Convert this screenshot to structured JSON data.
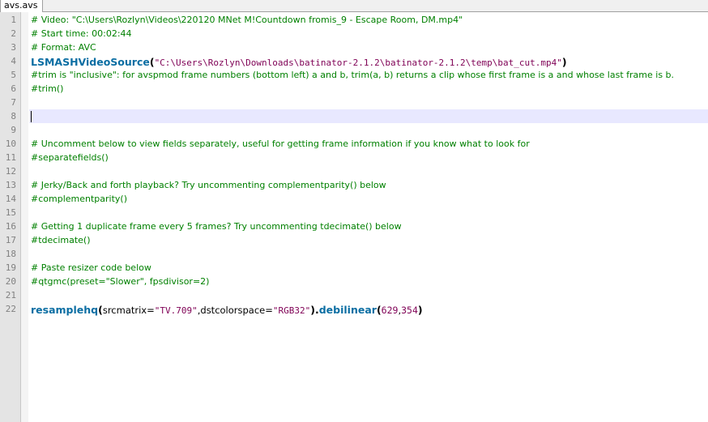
{
  "tab": {
    "label": "avs.avs"
  },
  "line_numbers": [
    "1",
    "2",
    "3",
    "4",
    "5",
    "6",
    "7",
    "8",
    "9",
    "10",
    "11",
    "12",
    "13",
    "14",
    "15",
    "16",
    "17",
    "18",
    "19",
    "20",
    "21",
    "22"
  ],
  "lines": {
    "l1": "# Video: \"C:\\Users\\Rozlyn\\Videos\\220120 MNet M!Countdown fromis_9 - Escape Room, DM.mp4\"",
    "l2": "# Start time: 00:02:44",
    "l3": "# Format: AVC",
    "l4": {
      "fn": "LSMASHVideoSource",
      "open": "(",
      "str": "\"C:\\Users\\Rozlyn\\Downloads\\batinator-2.1.2\\batinator-2.1.2\\temp\\bat_cut.mp4\"",
      "close": ")"
    },
    "l5": "#trim is \"inclusive\": for avspmod frame numbers (bottom left) a and b, trim(a, b) returns a clip whose first frame is a and whose last frame is b.",
    "l6": "#trim()",
    "l10": "# Uncomment below to view fields separately, useful for getting frame information if you know what to look for",
    "l11": "#separatefields()",
    "l13": "# Jerky/Back and forth playback? Try uncommenting complementparity() below",
    "l14": "#complementparity()",
    "l16": "# Getting 1 duplicate frame every 5 frames? Try uncommenting tdecimate() below",
    "l17": "#tdecimate()",
    "l19": "# Paste resizer code below",
    "l20": "#qtgmc(preset=\"Slower\", fpsdivisor=2)",
    "l22": {
      "fn1": "resamplehq",
      "open1": "(",
      "arg1": "srcmatrix=",
      "str1": "\"TV.709\"",
      "comma1": ",",
      "arg2": "dstcolorspace=",
      "str2": "\"RGB32\"",
      "close1": ")",
      "dot": ".",
      "fn2": "debilinear",
      "open2": "(",
      "num1": "629",
      "comma2": ",",
      "num2": "354",
      "close2": ")"
    }
  },
  "colors": {
    "comment": "#008000",
    "function": "#0b6ea3",
    "string": "#7f0055",
    "current_line": "#e8e8ff",
    "gutter": "#e4e4e4"
  }
}
